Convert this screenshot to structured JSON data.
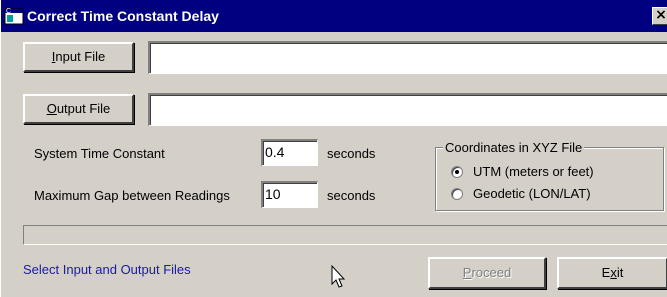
{
  "window": {
    "title": "Correct Time Constant Delay",
    "close_symbol": "×"
  },
  "files": {
    "input_button": {
      "accel": "I",
      "rest": "nput File"
    },
    "input_value": "",
    "output_button": {
      "accel": "O",
      "rest": "utput File"
    },
    "output_value": ""
  },
  "settings": {
    "time_constant_label": "System Time Constant",
    "time_constant_value": "0.4",
    "time_constant_unit": "seconds",
    "max_gap_label": "Maximum Gap between Readings",
    "max_gap_value": "10",
    "max_gap_unit": "seconds"
  },
  "coordinates": {
    "group_label": "Coordinates in XYZ File",
    "options": [
      {
        "label": "UTM (meters or feet)",
        "selected": true
      },
      {
        "label": "Geodetic (LON/LAT)",
        "selected": false
      }
    ]
  },
  "progress": {
    "value": 0
  },
  "status": {
    "text": "Select Input and Output Files",
    "color": "#1a1aa6"
  },
  "actions": {
    "proceed": {
      "accel": "P",
      "rest": "roceed",
      "enabled": false
    },
    "exit": {
      "pre": "E",
      "accel": "x",
      "rest": "it"
    }
  },
  "icons": {
    "app": "app-window-icon",
    "cursor": "mouse-pointer-icon"
  },
  "colors": {
    "titlebar": "#000080",
    "face": "#d4d0c8",
    "status_text": "#1a1aa6"
  }
}
